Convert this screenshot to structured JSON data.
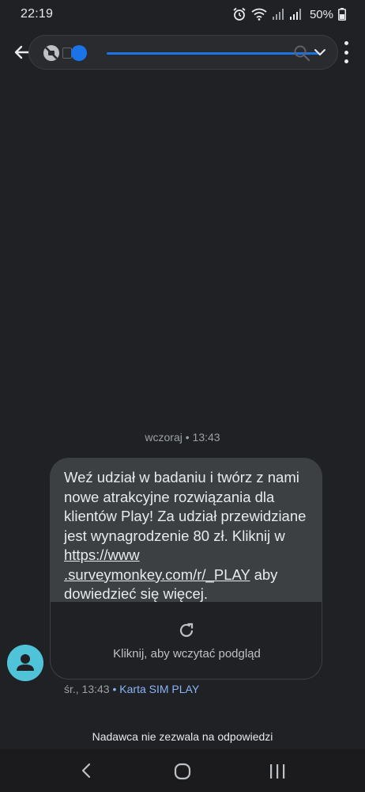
{
  "status_bar": {
    "time": "22:19",
    "battery": "50%",
    "icons": [
      "alarm-icon",
      "wifi-icon",
      "signal-icon",
      "signal-icon",
      "battery-icon"
    ]
  },
  "app_bar": {
    "icons": [
      "back-arrow-icon",
      "blocked-icon",
      "search-icon",
      "chevron-down-icon",
      "more-vert-icon"
    ]
  },
  "conversation": {
    "day_stamp": "wczoraj • 13:43",
    "message": {
      "text_before_link": "Weź udział w badaniu i twórz z nami nowe atrakcyjne rozwiązania dla klientów Play! Za udział przewidziane jest wynagrodzenie 80 zł. Kliknij w ",
      "link_text": "https://www .surveymonkey.com/r/_PLAY",
      "text_after_link": " aby dowiedzieć się więcej.",
      "preview_label": "Kliknij, aby wczytać podgląd"
    },
    "meta": {
      "time": "śr., 13:43",
      "separator": "•",
      "sim": "Karta SIM PLAY"
    },
    "no_reply_note": "Nadawca nie zezwala na odpowiedzi"
  },
  "colors": {
    "background": "#202124",
    "bubble": "#3c4043",
    "accent": "#1a73e8",
    "avatar": "#4fc3d8",
    "sim_label": "#8ab4f8"
  }
}
